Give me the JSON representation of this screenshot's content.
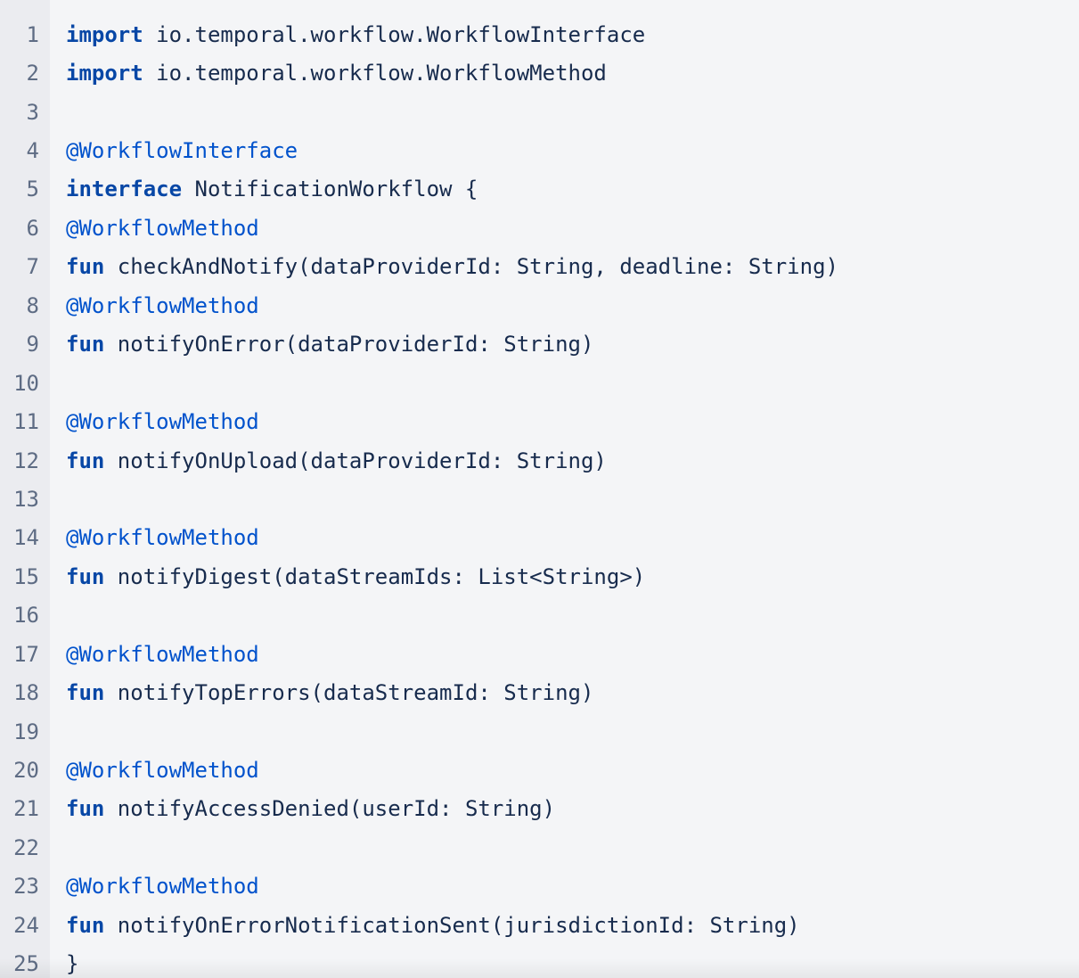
{
  "colors": {
    "background": "#f4f5f7",
    "gutter": "#ebecf0",
    "line_number": "#5e6c84",
    "text": "#172b4d",
    "keyword": "#0747a6",
    "annotation": "#0052cc"
  },
  "code_lines": [
    {
      "n": "1",
      "kw": "import",
      "text": " io.temporal.workflow.WorkflowInterface"
    },
    {
      "n": "2",
      "kw": "import",
      "text": " io.temporal.workflow.WorkflowMethod"
    },
    {
      "n": "3",
      "text": ""
    },
    {
      "n": "4",
      "annotation": "@WorkflowInterface"
    },
    {
      "n": "5",
      "kw": "interface",
      "text": " NotificationWorkflow {"
    },
    {
      "n": "6",
      "annotation": "@WorkflowMethod"
    },
    {
      "n": "7",
      "kw": "fun",
      "text": " checkAndNotify(dataProviderId: String, deadline: String)"
    },
    {
      "n": "8",
      "annotation": "@WorkflowMethod"
    },
    {
      "n": "9",
      "kw": "fun",
      "text": " notifyOnError(dataProviderId: String)"
    },
    {
      "n": "10",
      "text": ""
    },
    {
      "n": "11",
      "annotation": "@WorkflowMethod"
    },
    {
      "n": "12",
      "kw": "fun",
      "text": " notifyOnUpload(dataProviderId: String)"
    },
    {
      "n": "13",
      "text": ""
    },
    {
      "n": "14",
      "annotation": "@WorkflowMethod"
    },
    {
      "n": "15",
      "kw": "fun",
      "text": " notifyDigest(dataStreamIds: List<String>)"
    },
    {
      "n": "16",
      "text": ""
    },
    {
      "n": "17",
      "annotation": "@WorkflowMethod"
    },
    {
      "n": "18",
      "kw": "fun",
      "text": " notifyTopErrors(dataStreamId: String)"
    },
    {
      "n": "19",
      "text": ""
    },
    {
      "n": "20",
      "annotation": "@WorkflowMethod"
    },
    {
      "n": "21",
      "kw": "fun",
      "text": " notifyAccessDenied(userId: String)"
    },
    {
      "n": "22",
      "text": ""
    },
    {
      "n": "23",
      "annotation": "@WorkflowMethod"
    },
    {
      "n": "24",
      "kw": "fun",
      "text": " notifyOnErrorNotificationSent(jurisdictionId: String)"
    },
    {
      "n": "25",
      "text": "}"
    }
  ]
}
